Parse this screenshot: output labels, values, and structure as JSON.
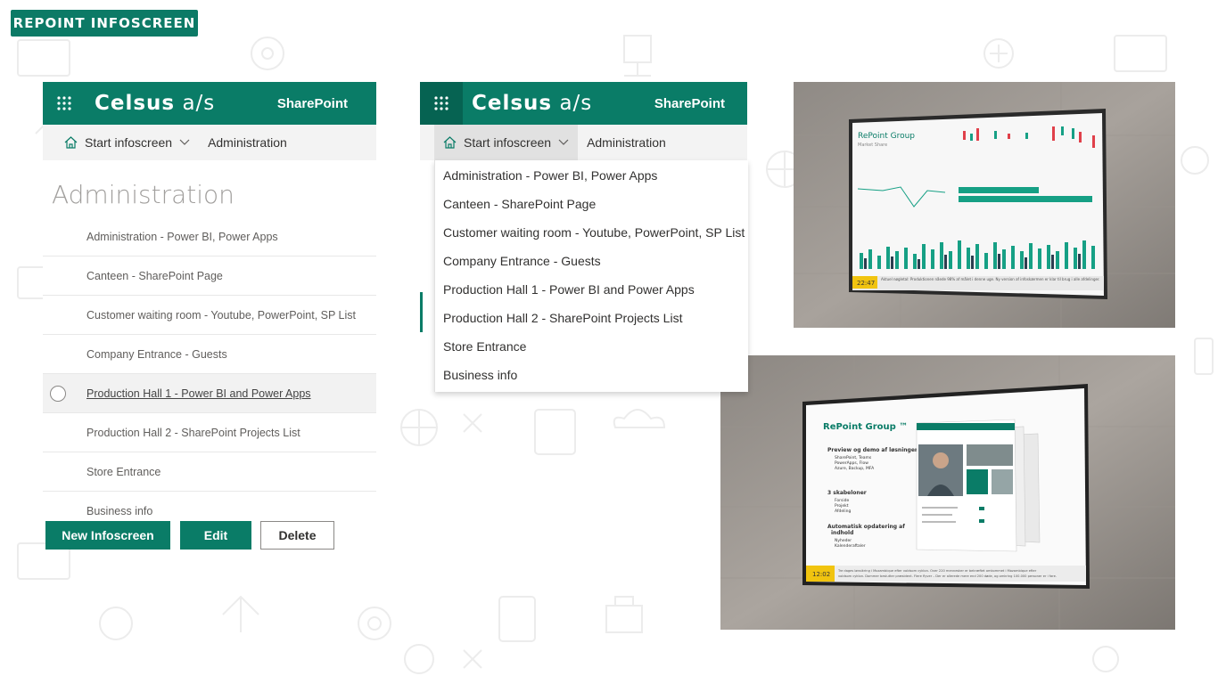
{
  "badge": {
    "label": "REPOINT INFOSCREEN"
  },
  "header": {
    "brand_bold": "Celsus",
    "brand_light": "a/s",
    "app": "SharePoint"
  },
  "nav": {
    "home_label": "Start infoscreen",
    "admin_label": "Administration"
  },
  "page_title": "Administration",
  "infoscreens": [
    {
      "label": "Administration - Power BI, Power Apps"
    },
    {
      "label": "Canteen - SharePoint Page"
    },
    {
      "label": "Customer waiting room - Youtube, PowerPoint, SP List"
    },
    {
      "label": "Company Entrance - Guests"
    },
    {
      "label": "Production Hall 1 - Power BI and Power Apps"
    },
    {
      "label": "Production Hall 2 - SharePoint Projects List"
    },
    {
      "label": "Store Entrance"
    },
    {
      "label": "Business info"
    }
  ],
  "buttons": {
    "new": "New Infoscreen",
    "edit": "Edit",
    "delete": "Delete"
  },
  "screen1": {
    "title": "RePoint Group",
    "subtitle": "Market Share",
    "clock": "22:47",
    "ticker": "Aktuel nøgletal: Produktionen nåede 98% af målet i denne uge. Ny version af infoskærmen er klar til brug i alle afdelinger."
  },
  "screen2": {
    "title": "RePoint Group ™",
    "bullet1": "Preview og demo af løsninger",
    "sub1": [
      "SharePoint, Teams",
      "PowerApps, Flow",
      "Azure, Backup, MFA"
    ],
    "bullet2": "3 skabeloner",
    "sub2": [
      "Forside",
      "Projekt",
      "Afdeling"
    ],
    "bullet3a": "Automatisk opdatering af",
    "bullet3b": "indhold",
    "sub3": [
      "Nyheder",
      "Kalenderaftaler"
    ],
    "clock": "12:02",
    "ticker1": "Tre dages lønsikring i Mozambique efter voldsom cyklon. Over 220 mennesker er bekræftet omkommet i Mozambique efter",
    "ticker2": "voldsom cyklon. Dommer beslutter præsident. Flere flyver – Der er allerede mere end 200 døde, og omkring 100.000 personer er i fare."
  },
  "colors": {
    "brand": "#0a7c67",
    "accent_teal": "#16a085",
    "bar_red": "#e0404a",
    "clock_yellow": "#f1c40f"
  }
}
